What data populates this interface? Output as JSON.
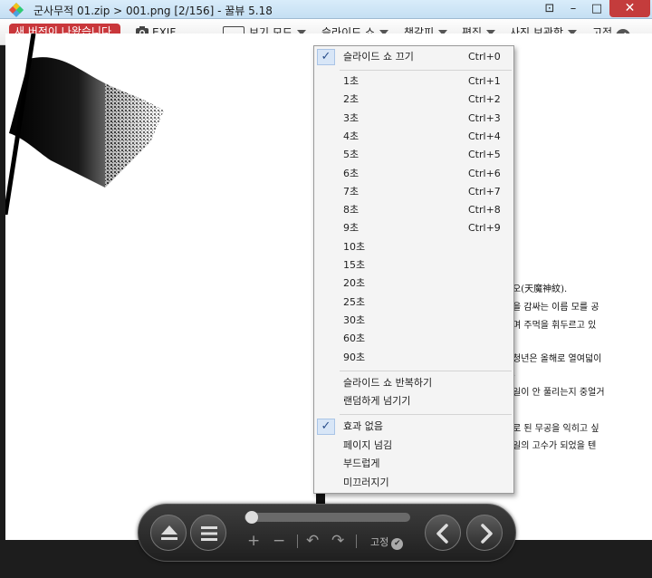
{
  "window": {
    "title": "군사무적 01.zip  >  001.png  [2/156]  -  꿀뷰 5.18",
    "minimize": "–",
    "maximize": "□",
    "close": "✕",
    "pin": "⊡"
  },
  "toolbar": {
    "new_version": "새 버전이 나왔습니다.",
    "exif": "EXIF",
    "view_mode": "보기 모드",
    "slideshow": "슬라이드 쇼",
    "bookmark": "책갈피",
    "edit": "편집",
    "photo_store": "사진 보관함",
    "fixed": "고정"
  },
  "menu": {
    "stop": {
      "label": "슬라이드 쇼 끄기",
      "shortcut": "Ctrl+0",
      "checked": true
    },
    "intervals": [
      {
        "label": "1초",
        "shortcut": "Ctrl+1"
      },
      {
        "label": "2초",
        "shortcut": "Ctrl+2"
      },
      {
        "label": "3초",
        "shortcut": "Ctrl+3"
      },
      {
        "label": "4초",
        "shortcut": "Ctrl+4"
      },
      {
        "label": "5초",
        "shortcut": "Ctrl+5"
      },
      {
        "label": "6초",
        "shortcut": "Ctrl+6"
      },
      {
        "label": "7초",
        "shortcut": "Ctrl+7"
      },
      {
        "label": "8초",
        "shortcut": "Ctrl+8"
      },
      {
        "label": "9초",
        "shortcut": "Ctrl+9"
      },
      {
        "label": "10초",
        "shortcut": ""
      },
      {
        "label": "15초",
        "shortcut": ""
      },
      {
        "label": "20초",
        "shortcut": ""
      },
      {
        "label": "25초",
        "shortcut": ""
      },
      {
        "label": "30초",
        "shortcut": ""
      },
      {
        "label": "60초",
        "shortcut": ""
      },
      {
        "label": "90초",
        "shortcut": ""
      }
    ],
    "repeat": "슬라이드 쇼 반복하기",
    "random": "랜덤하게 넘기기",
    "effects": [
      {
        "label": "효과 없음",
        "checked": true
      },
      {
        "label": "페이지 넘김",
        "checked": false
      },
      {
        "label": "부드럽게",
        "checked": false
      },
      {
        "label": "미끄러지기",
        "checked": false
      }
    ]
  },
  "page_text": [
    "오(天魔神紋).",
    "을 감싸는 이름 모를 공",
    "며 주먹을 휘두르고 있",
    "청년은 올해로 열여덟이",
    ".",
    "일이 안 풀리는지 중얼거",
    "로 된 무공을 익히고 싶",
    "일의 고수가 되었을 텐"
  ],
  "controls": {
    "zoom_in": "+",
    "zoom_out": "−",
    "rotate_left": "↶",
    "rotate_right": "↷",
    "fixed": "고정",
    "progress": 0.02
  }
}
